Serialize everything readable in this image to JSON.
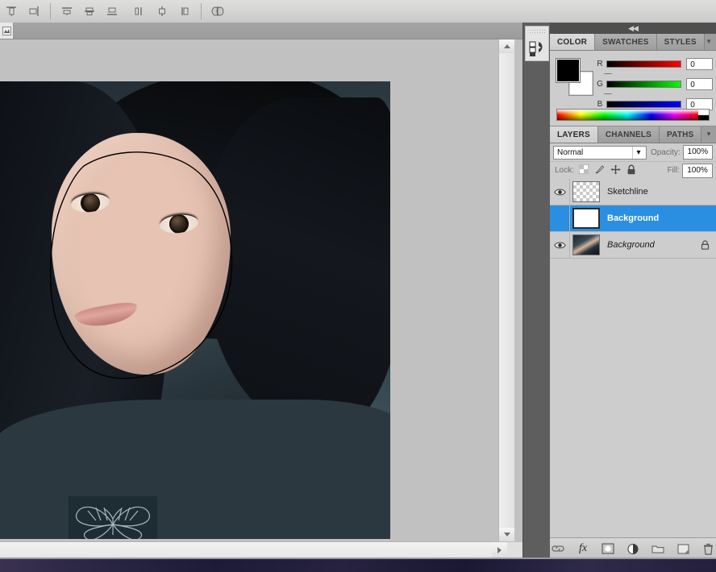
{
  "options_bar": {
    "icons": [
      {
        "name": "align-top-edges-icon",
        "glyph": "align-top"
      },
      {
        "name": "align-vertical-centers-icon",
        "glyph": "align-vcenter"
      },
      {
        "name": "align-bottom-edges-icon",
        "glyph": "align-bottom"
      },
      {
        "name": "align-left-edges-icon",
        "glyph": "align-left"
      },
      {
        "name": "align-horizontal-centers-icon",
        "glyph": "align-hcenter"
      },
      {
        "name": "align-right-edges-icon",
        "glyph": "align-right"
      },
      {
        "name": "distribute-top-icon",
        "glyph": "dist-top"
      },
      {
        "name": "distribute-vertical-center-icon",
        "glyph": "dist-vcenter"
      },
      {
        "name": "distribute-bottom-icon",
        "glyph": "dist-bottom"
      },
      {
        "name": "auto-align-layers-icon",
        "glyph": "auto-align"
      }
    ]
  },
  "document": {
    "tab_stub_label": "",
    "canvas": {
      "image_alt": "photo of a young woman in a car with a lasso selection drawn around her face"
    }
  },
  "mini_dock": {
    "buttons": [
      {
        "name": "history-panel-icon",
        "label": ""
      }
    ]
  },
  "dock": {
    "collapse_label": "◀◀"
  },
  "color_panel": {
    "tabs": [
      {
        "label": "COLOR",
        "active": true
      },
      {
        "label": "SWATCHES",
        "active": false
      },
      {
        "label": "STYLES",
        "active": false
      }
    ],
    "menu_glyph": "▾",
    "foreground_color": "#000000",
    "background_color": "#ffffff",
    "channels": [
      {
        "label": "R",
        "value": "0",
        "ramp_to": "#ff0000"
      },
      {
        "label": "G",
        "value": "0",
        "ramp_to": "#00ff00"
      },
      {
        "label": "B",
        "value": "0",
        "ramp_to": "#0000ff"
      }
    ]
  },
  "layers_panel": {
    "tabs": [
      {
        "label": "LAYERS",
        "active": true
      },
      {
        "label": "CHANNELS",
        "active": false
      },
      {
        "label": "PATHS",
        "active": false
      }
    ],
    "menu_glyph": "▾",
    "blend_mode": "Normal",
    "blend_caret": "▾",
    "opacity_label": "Opacity:",
    "opacity_value": "100%",
    "lock_label": "Lock:",
    "lock_icons": [
      {
        "name": "lock-transparent-pixels-icon"
      },
      {
        "name": "lock-image-pixels-icon"
      },
      {
        "name": "lock-position-icon"
      },
      {
        "name": "lock-all-icon"
      }
    ],
    "fill_label": "Fill:",
    "fill_value": "100%",
    "layers": [
      {
        "name": "Sketchline",
        "visible": true,
        "selected": false,
        "italic": false,
        "locked": false,
        "thumb": "transparent"
      },
      {
        "name": "Background",
        "visible": false,
        "selected": true,
        "italic": false,
        "locked": false,
        "thumb": "white"
      },
      {
        "name": "Background",
        "visible": true,
        "selected": false,
        "italic": true,
        "locked": true,
        "thumb": "photo"
      }
    ],
    "bottom_buttons": [
      {
        "name": "link-layers-icon",
        "label": ""
      },
      {
        "name": "layer-style-fx-icon",
        "label": "fx"
      },
      {
        "name": "add-layer-mask-icon",
        "label": ""
      },
      {
        "name": "new-adjustment-layer-icon",
        "label": ""
      },
      {
        "name": "new-group-icon",
        "label": ""
      },
      {
        "name": "new-layer-icon",
        "label": ""
      },
      {
        "name": "delete-layer-icon",
        "label": ""
      }
    ]
  },
  "scrollbars": {
    "vertical_up": "▲",
    "vertical_down": "▼",
    "horizontal_right": "▶"
  },
  "colors": {
    "selection_blue": "#2a8fe0",
    "panel_bg": "#cdcdcd",
    "dock_bg": "#5e5e5e",
    "canvas_bg": "#c1c1c1"
  }
}
